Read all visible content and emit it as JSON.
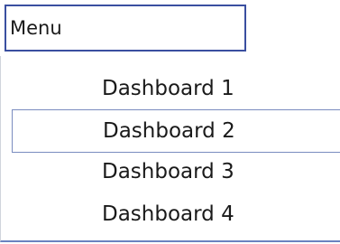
{
  "menu": {
    "button_label": "Menu",
    "items": [
      {
        "label": "Dashboard 1"
      },
      {
        "label": "Dashboard 2",
        "focused": true
      },
      {
        "label": "Dashboard 3"
      },
      {
        "label": "Dashboard 4"
      }
    ]
  },
  "colors": {
    "button_border": "#3a4fa0",
    "focus_border": "#7a8cbf",
    "dropdown_bottom_border": "#6a82c0"
  }
}
